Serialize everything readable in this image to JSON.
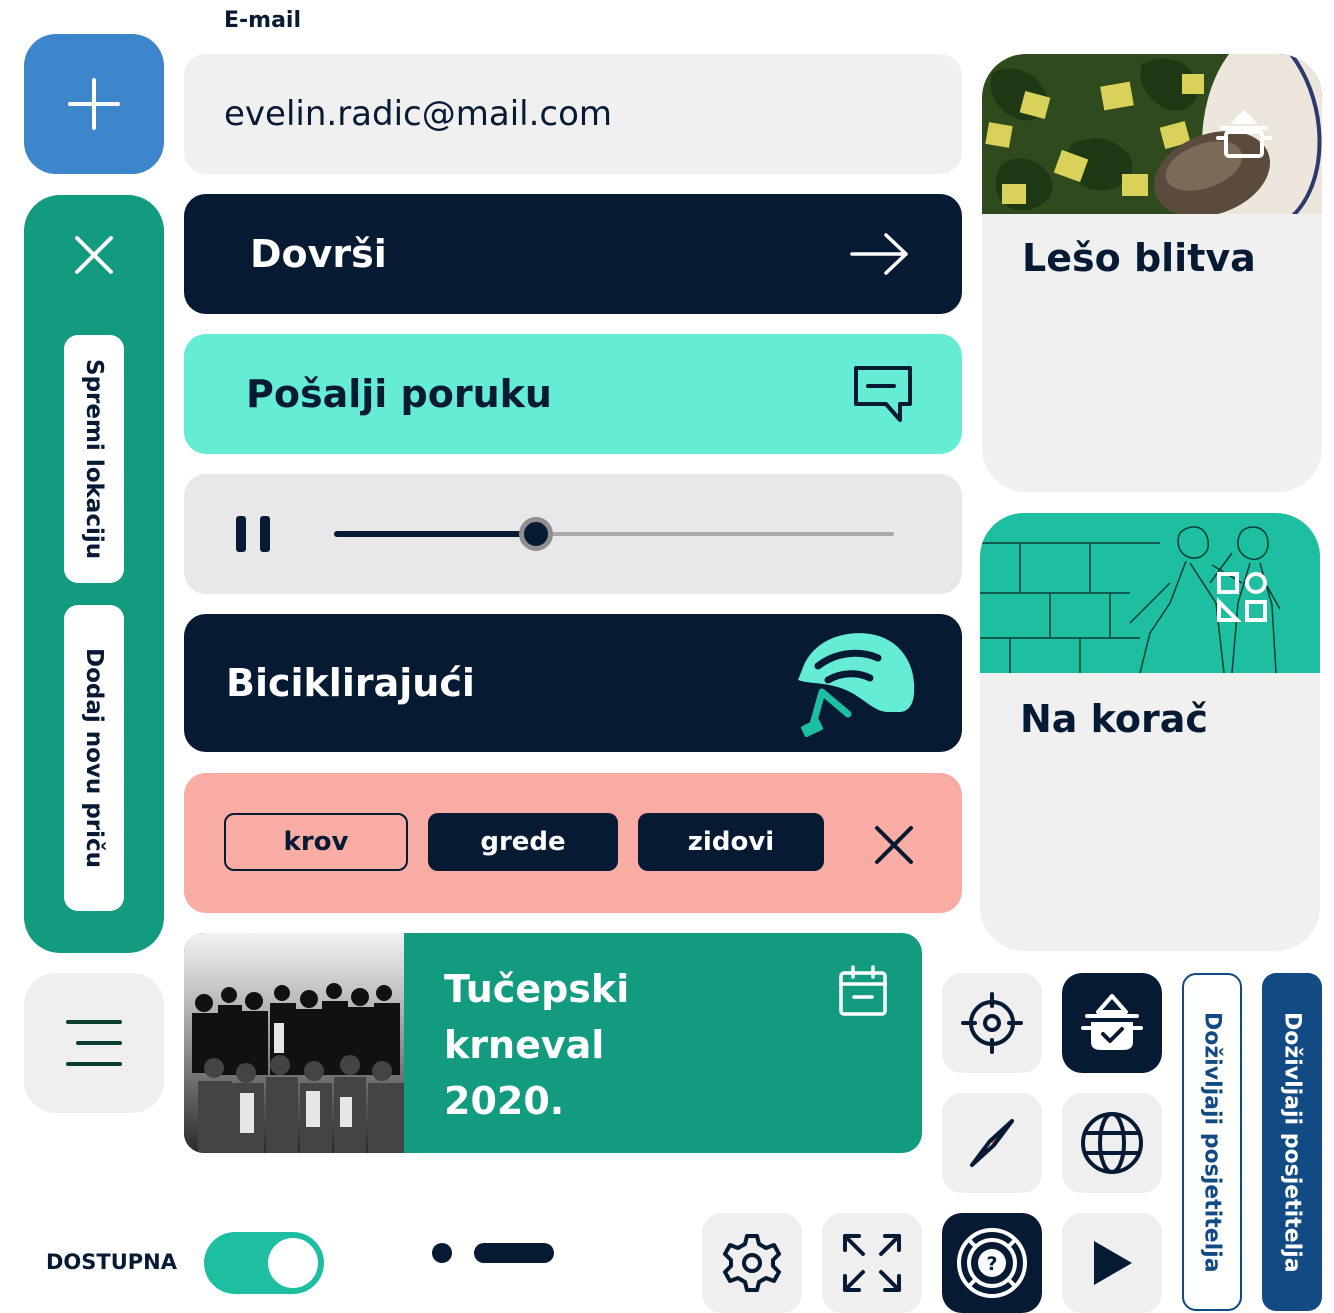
{
  "email": {
    "label": "E-mail",
    "value": "evelin.radic@mail.com"
  },
  "side_panel": {
    "save_location": "Spremi lokaciju",
    "add_story": "Dodaj novu priču"
  },
  "buttons": {
    "finish": "Dovrši",
    "send_message": "Pošalji poruku",
    "cycling": "Biciklirajući"
  },
  "player": {
    "progress": 0.36,
    "state": "playing"
  },
  "tags": {
    "items": [
      "krov",
      "grede",
      "zidovi"
    ],
    "selected": [
      false,
      true,
      true
    ]
  },
  "event": {
    "title_lines": [
      "Tučepski",
      "krneval",
      "2020."
    ]
  },
  "cards": [
    {
      "title": "Lešo blitva",
      "icon": "cooking-pot-icon"
    },
    {
      "title": "Na korač",
      "icon": "shapes-icon"
    }
  ],
  "vertical_buttons": {
    "outlined": "Doživljaji posjetitelja",
    "filled": "Doživljaji posjetitelja"
  },
  "availability": {
    "label": "DOSTUPNA",
    "on": true
  },
  "pagination": {
    "count": 2,
    "active": 1
  },
  "colors": {
    "navy": "#071a34",
    "teal": "#129b7f",
    "mint": "#65ecd4",
    "blue": "#3e86cc",
    "salmon": "#f8aca4",
    "toggle": "#1dbfa0",
    "dark_blue": "#124a84"
  }
}
